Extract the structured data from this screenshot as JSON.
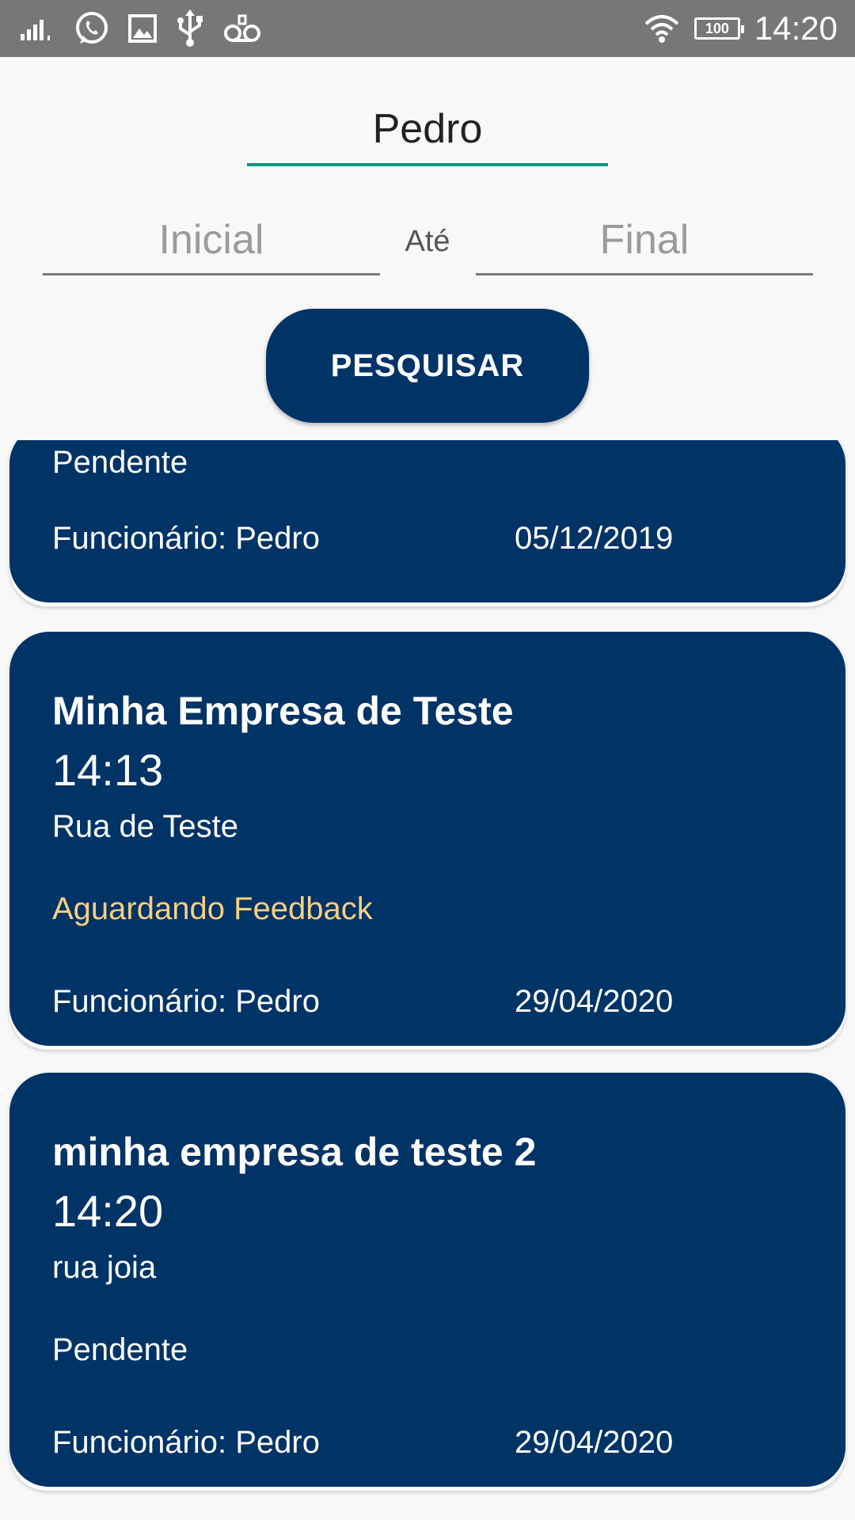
{
  "status_bar": {
    "time": "14:20",
    "battery": "100",
    "icons_left": [
      "signal-icon",
      "whatsapp-icon",
      "gallery-icon",
      "usb-icon",
      "voicemail-icon"
    ],
    "icons_right": [
      "wifi-icon",
      "battery-icon"
    ]
  },
  "search": {
    "name_value": "Pedro",
    "initial_placeholder": "Inicial",
    "between_label": "Até",
    "final_placeholder": "Final",
    "button_label": "PESQUISAR"
  },
  "colors": {
    "primary": "#003366",
    "accent": "#0f9484",
    "feedback_status": "#f7cf81"
  },
  "records": [
    {
      "status": "Pendente",
      "employee": "Funcionário: Pedro",
      "date": "05/12/2019"
    },
    {
      "company": "Minha Empresa de Teste",
      "time": "14:13",
      "street": "Rua de Teste",
      "status": "Aguardando Feedback",
      "employee": "Funcionário: Pedro",
      "date": "29/04/2020"
    },
    {
      "company": "minha empresa de teste 2",
      "time": "14:20",
      "street": "rua joia",
      "status": "Pendente",
      "employee": "Funcionário: Pedro",
      "date": "29/04/2020"
    }
  ]
}
